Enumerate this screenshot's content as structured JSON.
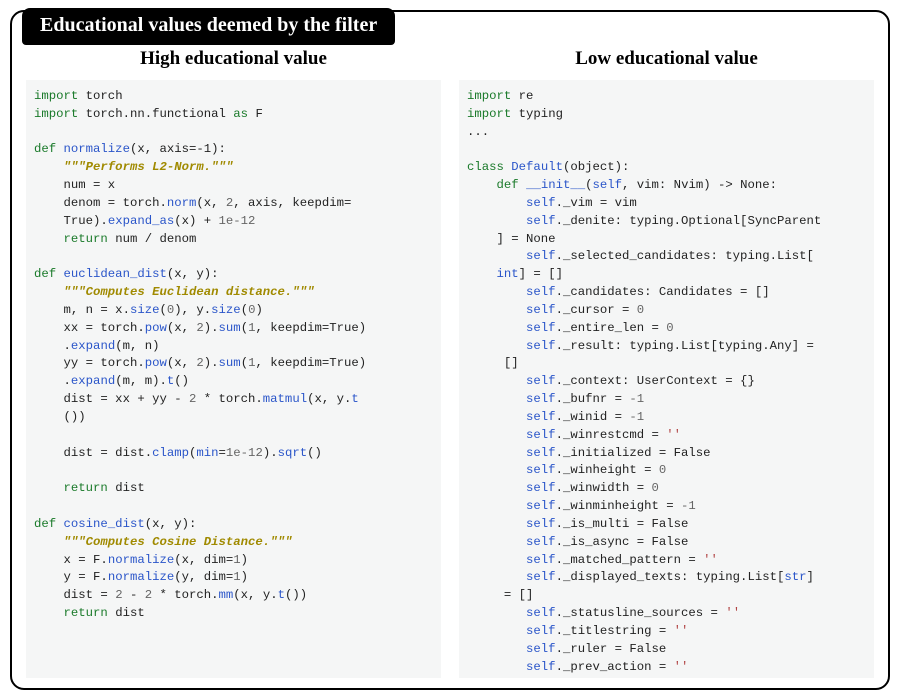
{
  "frame_title": "Educational values deemed by the filter",
  "left": {
    "heading": "High educational value",
    "imports": [
      {
        "kw": "import",
        "mod": "torch"
      },
      {
        "kw": "import",
        "mod": "torch.nn.functional",
        "as": "as",
        "alias": "F"
      }
    ],
    "fn1": {
      "def": "def",
      "name": "normalize",
      "params": "(x, axis=-1):",
      "doc": "\"\"\"Performs L2-Norm.\"\"\"",
      "l1a": "num = x",
      "l2a": "denom = torch.",
      "l2b": "norm",
      "l2c": "(x, ",
      "l2d": "2",
      "l2e": ", axis, keepdim=",
      "l3a": "True).",
      "l3b": "expand_as",
      "l3c": "(x) + ",
      "l3d": "1e-12",
      "ret": "return",
      "retv": " num / denom"
    },
    "fn2": {
      "def": "def",
      "name": "euclidean_dist",
      "params": "(x, y):",
      "doc": "\"\"\"Computes Euclidean distance.\"\"\"",
      "l1": "m, n = x.",
      "l1b": "size",
      "l1c": "(",
      "l1d": "0",
      "l1e": "), y.",
      "l1f": "size",
      "l1g": "(",
      "l1h": "0",
      "l1i": ")",
      "l2": "xx = torch.",
      "l2b": "pow",
      "l2c": "(x, ",
      "l2d": "2",
      "l2e": ").",
      "l2f": "sum",
      "l2g": "(",
      "l2h": "1",
      "l2i": ", keepdim=True)",
      "l3": ".",
      "l3b": "expand",
      "l3c": "(m, n)",
      "l4": "yy = torch.",
      "l4b": "pow",
      "l4c": "(x, ",
      "l4d": "2",
      "l4e": ").",
      "l4f": "sum",
      "l4g": "(",
      "l4h": "1",
      "l4i": ", keepdim=True)",
      "l5": ".",
      "l5b": "expand",
      "l5c": "(m, m).",
      "l5d": "t",
      "l5e": "()",
      "l6": "dist = xx + yy - ",
      "l6b": "2",
      "l6c": " * torch.",
      "l6d": "matmul",
      "l6e": "(x, y.",
      "l6f": "t",
      "l7": "())",
      "l8": "dist = dist.",
      "l8b": "clamp",
      "l8c": "(",
      "l8d": "min",
      "l8e": "=",
      "l8f": "1e-12",
      "l8g": ").",
      "l8h": "sqrt",
      "l8i": "()",
      "ret": "return",
      "retv": " dist"
    },
    "fn3": {
      "def": "def",
      "name": "cosine_dist",
      "params": "(x, y):",
      "doc": "\"\"\"Computes Cosine Distance.\"\"\"",
      "l1": "x = F.",
      "l1b": "normalize",
      "l1c": "(x, dim=",
      "l1d": "1",
      "l1e": ")",
      "l2": "y = F.",
      "l2b": "normalize",
      "l2c": "(y, dim=",
      "l2d": "1",
      "l2e": ")",
      "l3": "dist = ",
      "l3b": "2",
      "l3c": " - ",
      "l3d": "2",
      "l3e": " * torch.",
      "l3f": "mm",
      "l3g": "(x, y.",
      "l3h": "t",
      "l3i": "())",
      "ret": "return",
      "retv": " dist"
    }
  },
  "right": {
    "heading": "Low educational value",
    "imports": [
      {
        "kw": "import",
        "mod": "re"
      },
      {
        "kw": "import",
        "mod": "typing"
      }
    ],
    "ellipsis": "...",
    "cls": {
      "kw": "class",
      "name": "Default",
      "base": "(object):"
    },
    "init": {
      "def": "def",
      "name": "__init__",
      "params_a": "(",
      "self": "self",
      "params_b": ", vim: Nvim) -> None:",
      "lines": [
        {
          "a": "self",
          "b": "._vim = vim"
        },
        {
          "a": "self",
          "b": "._denite: typing.Optional[SyncParent",
          "wrap": "] = None"
        },
        {
          "a": "self",
          "b": "._selected_candidates: typing.List[",
          "wrap_blue": "int",
          "wrap2": "] = []"
        },
        {
          "a": "self",
          "b": "._candidates: Candidates = []"
        },
        {
          "a": "self",
          "b": "._cursor = ",
          "num": "0"
        },
        {
          "a": "self",
          "b": "._entire_len = ",
          "num": "0"
        },
        {
          "a": "self",
          "b": "._result: typing.List[typing.Any] =",
          "wrap": " []"
        },
        {
          "a": "self",
          "b": "._context: UserContext = {}"
        },
        {
          "a": "self",
          "b": "._bufnr = ",
          "num": "-1"
        },
        {
          "a": "self",
          "b": "._winid = ",
          "num": "-1"
        },
        {
          "a": "self",
          "b": "._winrestcmd = ",
          "str": "''"
        },
        {
          "a": "self",
          "b": "._initialized = False"
        },
        {
          "a": "self",
          "b": "._winheight = ",
          "num": "0"
        },
        {
          "a": "self",
          "b": "._winwidth = ",
          "num": "0"
        },
        {
          "a": "self",
          "b": "._winminheight = ",
          "num": "-1"
        },
        {
          "a": "self",
          "b": "._is_multi = False"
        },
        {
          "a": "self",
          "b": "._is_async = False"
        },
        {
          "a": "self",
          "b": "._matched_pattern = ",
          "str": "''"
        },
        {
          "a": "self",
          "b": "._displayed_texts: typing.List[",
          "wrap_blue": "str",
          "wrap2": "]",
          "wrap3": " = []"
        },
        {
          "a": "self",
          "b": "._statusline_sources = ",
          "str": "''"
        },
        {
          "a": "self",
          "b": "._titlestring = ",
          "str": "''"
        },
        {
          "a": "self",
          "b": "._ruler = False"
        },
        {
          "a": "self",
          "b": "._prev_action = ",
          "str": "''"
        }
      ],
      "trailing": "..."
    }
  }
}
